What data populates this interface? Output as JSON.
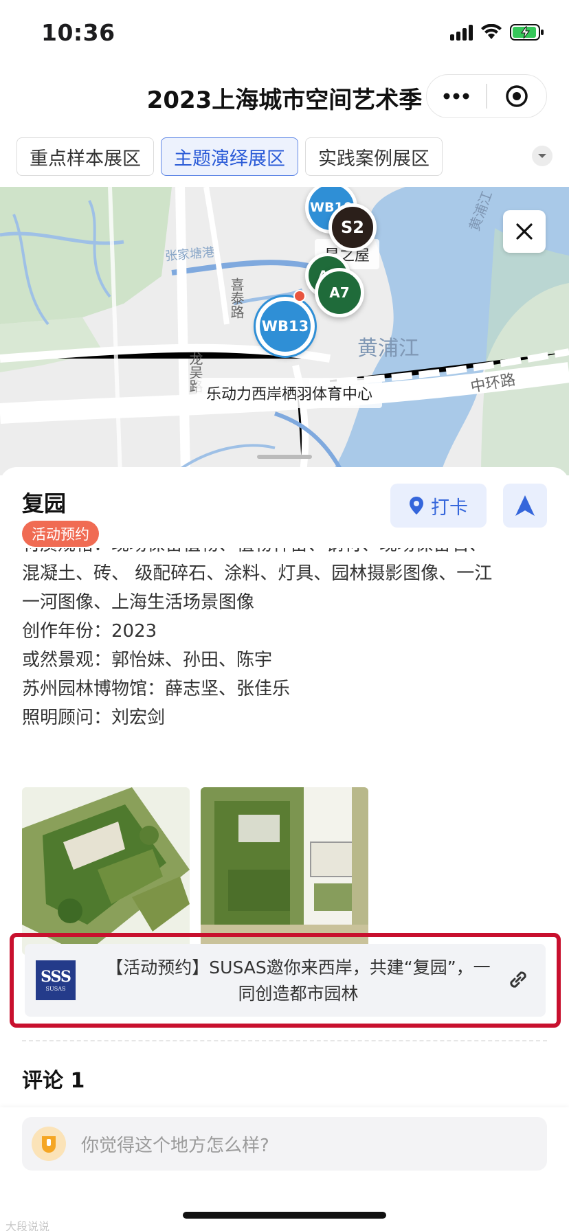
{
  "status_bar": {
    "time": "10:36"
  },
  "header": {
    "title": "2023上海城市空间艺术季"
  },
  "tabs": [
    {
      "label": "重点样本展区",
      "active": false
    },
    {
      "label": "主题演绎展区",
      "active": true
    },
    {
      "label": "实践案例展区",
      "active": false
    }
  ],
  "map": {
    "labels": {
      "river_name": "黄浦江",
      "river_name_vertical": "黄浦江",
      "road_1": "中环路",
      "road_2": "喜泰路",
      "road_3": "龙吴路",
      "road_4": "张家塘港"
    },
    "pins": [
      {
        "code": "WB10",
        "color": "#2f8fd6"
      },
      {
        "code": "S2",
        "color": "#2b1f1a"
      },
      {
        "code": "A6",
        "color": "#1f6b3a"
      },
      {
        "code": "A7",
        "color": "#1f6b3a"
      },
      {
        "code": "WB13",
        "color": "#2f8fd6"
      }
    ],
    "pin_label_top": "星之屋",
    "pin_label_selected": "乐动力西岸栖羽体育中心"
  },
  "detail": {
    "name": "复园",
    "tag": "活动预约",
    "checkin_label": "打卡",
    "description_lines": [
      "材质规格：现场保留植物、植物种苗、钢材、现场保留石、",
      "混凝土、砖、 级配碎石、涂料、灯具、园林摄影图像、一江",
      "一河图像、上海生活场景图像",
      "创作年份：2023",
      "或然景观：郭怡妹、孙田、陈宇",
      "苏州园林博物馆：薛志坚、张佳乐",
      "照明顾问：刘宏剑"
    ],
    "link": {
      "logo_big": "SSS",
      "logo_small": "SUSAS",
      "text": "【活动预约】SUSAS邀你来西岸，共建“复园”，一同创造都市园林"
    },
    "comments_title": "评论 1"
  },
  "comment_input": {
    "placeholder": "你觉得这个地方怎么样?"
  },
  "watermark": "大段说说"
}
